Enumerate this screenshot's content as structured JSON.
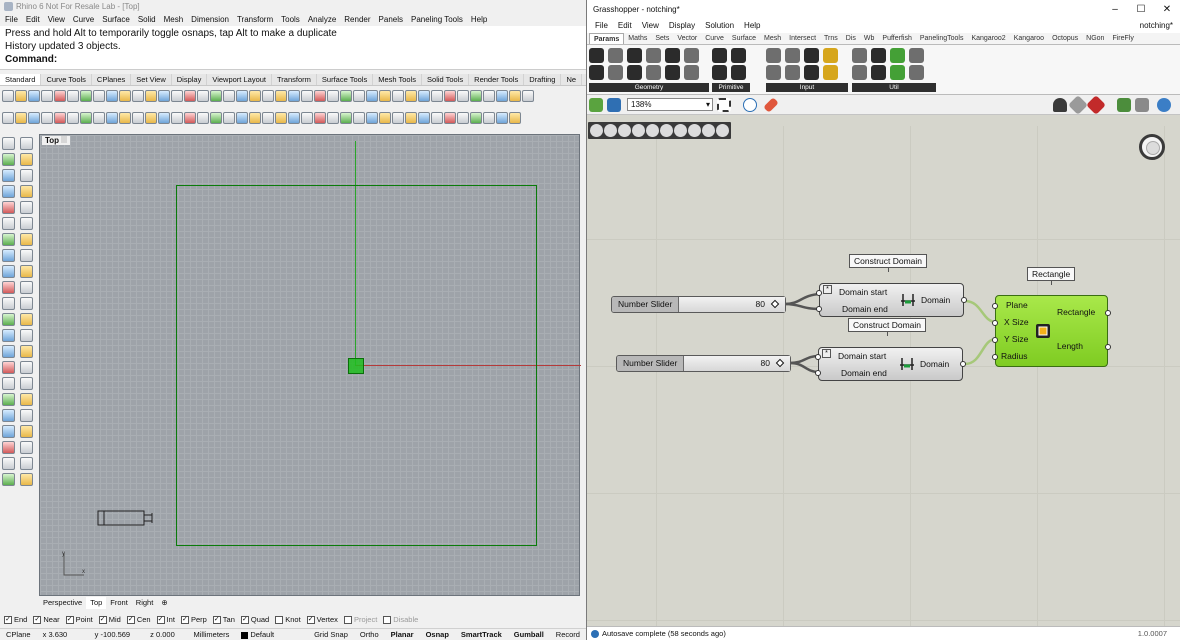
{
  "rhino": {
    "title": "Rhino 6 Not For Resale Lab - [Top]",
    "menu": [
      "File",
      "Edit",
      "View",
      "Curve",
      "Surface",
      "Solid",
      "Mesh",
      "Dimension",
      "Transform",
      "Tools",
      "Analyze",
      "Render",
      "Panels",
      "Paneling Tools",
      "Help"
    ],
    "command_history": [
      "Press and hold Alt to temporarily toggle osnaps, tap Alt to make a duplicate",
      "History updated 3 objects."
    ],
    "command_prompt": "Command:",
    "toolbar_tabs": [
      "Standard",
      "Curve Tools",
      "CPlanes",
      "Set View",
      "Display",
      "Viewport Layout",
      "Transform",
      "Surface Tools",
      "Mesh Tools",
      "Solid Tools",
      "Render Tools",
      "Drafting",
      "Ne"
    ],
    "viewport_label": "Top",
    "viewport_tabs": [
      "Perspective",
      "Top",
      "Front",
      "Right"
    ],
    "osnaps": [
      {
        "label": "End",
        "checked": true
      },
      {
        "label": "Near",
        "checked": true
      },
      {
        "label": "Point",
        "checked": true
      },
      {
        "label": "Mid",
        "checked": true
      },
      {
        "label": "Cen",
        "checked": true
      },
      {
        "label": "Int",
        "checked": true
      },
      {
        "label": "Perp",
        "checked": true
      },
      {
        "label": "Tan",
        "checked": true
      },
      {
        "label": "Quad",
        "checked": true
      },
      {
        "label": "Knot",
        "checked": false
      },
      {
        "label": "Vertex",
        "checked": true
      },
      {
        "label": "Project",
        "checked": false
      },
      {
        "label": "Disable",
        "checked": false
      }
    ],
    "status": {
      "cplane": "CPlane",
      "x": "x 3.630",
      "y": "y -100.569",
      "z": "z 0.000",
      "units": "Millimeters",
      "layer": "Default",
      "toggles": [
        "Grid Snap",
        "Ortho",
        "Planar",
        "Osnap",
        "SmartTrack",
        "Gumball",
        "Record"
      ]
    }
  },
  "grasshopper": {
    "title": "Grasshopper - notching*",
    "doc_name": "notching*",
    "menu": [
      "File",
      "Edit",
      "View",
      "Display",
      "Solution",
      "Help"
    ],
    "tabs": [
      "Params",
      "Maths",
      "Sets",
      "Vector",
      "Curve",
      "Surface",
      "Mesh",
      "Intersect",
      "Trns",
      "Dis",
      "Wb",
      "Pufferfish",
      "PanelingTools",
      "Kangaroo2",
      "Kangaroo",
      "Octopus",
      "NGon",
      "FireFly"
    ],
    "ribbon_groups": [
      "Geometry",
      "Primitive",
      "Input",
      "Util"
    ],
    "zoom": "138%",
    "sliders": [
      {
        "label": "Number Slider",
        "value": "80"
      },
      {
        "label": "Number Slider",
        "value": "80"
      }
    ],
    "construct_domain": {
      "title": "Construct Domain",
      "inputs": [
        "Domain start",
        "Domain end"
      ],
      "output": "Domain"
    },
    "rectangle": {
      "title": "Rectangle",
      "inputs": [
        "Plane",
        "X Size",
        "Y Size",
        "Radius"
      ],
      "outputs": [
        "Rectangle",
        "Length"
      ]
    },
    "status": "Autosave complete (58 seconds ago)",
    "version": "1.0.0007"
  },
  "colors": {
    "gh_canvas": "#d6d6cd",
    "rectangle_component": "#8fd62e",
    "rhino_viewport": "#9ea3a9",
    "curve_green": "#0a7c0a"
  }
}
